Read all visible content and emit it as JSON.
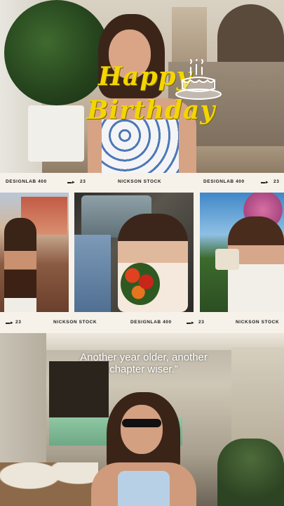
{
  "overlay": {
    "title_line1": "Happy",
    "title_line2": "Birthday",
    "title_color": "#f4d500",
    "cake_icon": "birthday-cake-icon"
  },
  "strip_top": {
    "left": "DESIGNLAB 400",
    "num1": "23",
    "center": "NICKSON STOCK",
    "right": "DESIGNLAB 400",
    "num2": "23"
  },
  "strip_bottom": {
    "num1": "23",
    "left": "NICKSON STOCK",
    "center": "DESIGNLAB 400",
    "num2": "23",
    "right": "NICKSON STOCK"
  },
  "quote": {
    "line1": "Another year older, another",
    "line2": "chapter wiser.”"
  }
}
